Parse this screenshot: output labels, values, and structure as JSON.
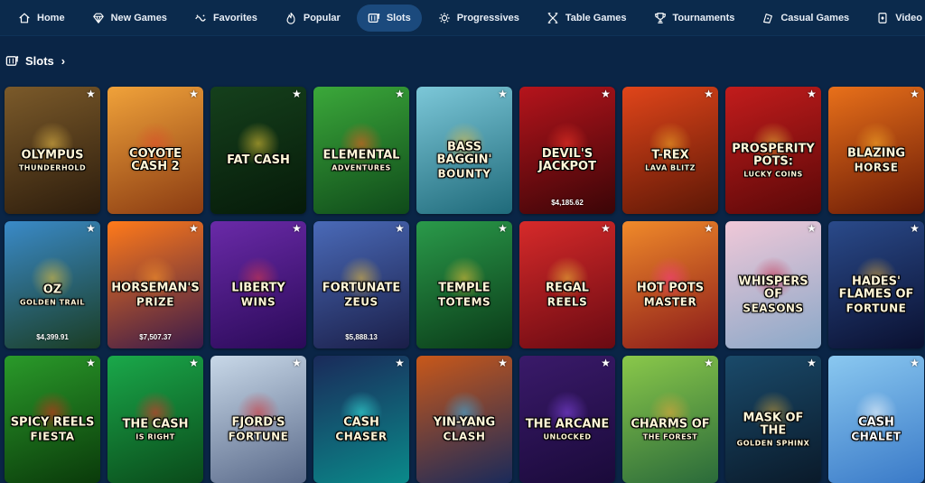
{
  "nav": {
    "items": [
      {
        "label": "Home",
        "icon": "home-icon",
        "active": false
      },
      {
        "label": "New Games",
        "icon": "diamond-icon",
        "active": false
      },
      {
        "label": "Favorites",
        "icon": "favorites-icon",
        "active": false
      },
      {
        "label": "Popular",
        "icon": "flame-icon",
        "active": false
      },
      {
        "label": "Slots",
        "icon": "slot-machine-icon",
        "active": true
      },
      {
        "label": "Progressives",
        "icon": "progressives-icon",
        "active": false
      },
      {
        "label": "Table Games",
        "icon": "cards-icon",
        "active": false
      },
      {
        "label": "Tournaments",
        "icon": "trophy-icon",
        "active": false
      },
      {
        "label": "Casual Games",
        "icon": "casual-icon",
        "active": false
      },
      {
        "label": "Video Poker",
        "icon": "video-poker-icon",
        "active": false
      }
    ]
  },
  "section": {
    "title": "Slots",
    "icon": "slot-machine-icon",
    "chevron": "›"
  },
  "games": [
    {
      "title": "Olympus",
      "subtitle": "Thunderhold",
      "jackpot": "",
      "bg": [
        "#7b5a2a",
        "#2c1c0c"
      ],
      "accent": "#f1c44b"
    },
    {
      "title": "Coyote Cash 2",
      "subtitle": "",
      "jackpot": "",
      "bg": [
        "#f0a23a",
        "#8a3b12"
      ],
      "accent": "#e14b2a"
    },
    {
      "title": "Fat Cash",
      "subtitle": "",
      "jackpot": "",
      "bg": [
        "#15401c",
        "#061a09"
      ],
      "accent": "#f5d23a"
    },
    {
      "title": "Elemental",
      "subtitle": "Adventures",
      "jackpot": "",
      "bg": [
        "#3ba83a",
        "#0f4a1a"
      ],
      "accent": "#ff5a1f"
    },
    {
      "title": "Bass Baggin'",
      "subtitle": "Bounty",
      "jackpot": "",
      "bg": [
        "#7cc7d8",
        "#1f6a7a"
      ],
      "accent": "#f2c23b"
    },
    {
      "title": "Devil's Jackpot",
      "subtitle": "",
      "jackpot": "$4,185.62",
      "bg": [
        "#b5141c",
        "#3a0507"
      ],
      "accent": "#ff3a2a"
    },
    {
      "title": "T-Rex",
      "subtitle": "Lava Blitz",
      "jackpot": "",
      "bg": [
        "#e0451a",
        "#5c1706"
      ],
      "accent": "#f7b02a"
    },
    {
      "title": "Prosperity Pots:",
      "subtitle": "Lucky Coins",
      "jackpot": "",
      "bg": [
        "#c21c1c",
        "#5a0808"
      ],
      "accent": "#f5c63a"
    },
    {
      "title": "Blazing",
      "subtitle": "Horse",
      "jackpot": "",
      "bg": [
        "#e8701a",
        "#6a1a06"
      ],
      "accent": "#ffb32a"
    },
    {
      "title": "Oz",
      "subtitle": "Golden Trail",
      "jackpot": "$4,399.91",
      "bg": [
        "#3a8ac8",
        "#1a3d24"
      ],
      "accent": "#f5c83a"
    },
    {
      "title": "Horseman's",
      "subtitle": "Prize",
      "jackpot": "$7,507.37",
      "bg": [
        "#ff7a1a",
        "#3a1a4a"
      ],
      "accent": "#ff9a2a"
    },
    {
      "title": "Liberty",
      "subtitle": "Wins",
      "jackpot": "",
      "bg": [
        "#6a2aa8",
        "#2a0a58"
      ],
      "accent": "#e23a4a"
    },
    {
      "title": "Fortunate",
      "subtitle": "Zeus",
      "jackpot": "$5,888.13",
      "bg": [
        "#4a6ab8",
        "#1a1e48"
      ],
      "accent": "#f5c63a"
    },
    {
      "title": "Temple",
      "subtitle": "Totems",
      "jackpot": "",
      "bg": [
        "#2a9a4a",
        "#0a3a18"
      ],
      "accent": "#f5c63a"
    },
    {
      "title": "Regal",
      "subtitle": "Reels",
      "jackpot": "",
      "bg": [
        "#d62a2a",
        "#6a0a12"
      ],
      "accent": "#f5c63a"
    },
    {
      "title": "Hot Pots",
      "subtitle": "Master",
      "jackpot": "",
      "bg": [
        "#f08a2a",
        "#8a1a1a"
      ],
      "accent": "#ff3a8a"
    },
    {
      "title": "Whispers of",
      "subtitle": "Seasons",
      "jackpot": "",
      "bg": [
        "#f0c8d8",
        "#8aa8c8"
      ],
      "accent": "#c81a3a"
    },
    {
      "title": "Hades' Flames of",
      "subtitle": "Fortune",
      "jackpot": "",
      "bg": [
        "#2a4a8a",
        "#0a1030"
      ],
      "accent": "#f5b83a"
    },
    {
      "title": "Spicy Reels",
      "subtitle": "Fiesta",
      "jackpot": "",
      "bg": [
        "#2a9a2a",
        "#0a3a0a"
      ],
      "accent": "#e8281a"
    },
    {
      "title": "The Cash",
      "subtitle": "is Right",
      "jackpot": "",
      "bg": [
        "#1aa84a",
        "#0a4a1a"
      ],
      "accent": "#ff2a2a"
    },
    {
      "title": "Fjord's",
      "subtitle": "Fortune",
      "jackpot": "",
      "bg": [
        "#c8d8e8",
        "#5a6a8a"
      ],
      "accent": "#d82a2a"
    },
    {
      "title": "Cash",
      "subtitle": "Chaser",
      "jackpot": "",
      "bg": [
        "#1a2a5a",
        "#0a8a8a"
      ],
      "accent": "#3af0e8"
    },
    {
      "title": "Yin-Yang",
      "subtitle": "Clash",
      "jackpot": "",
      "bg": [
        "#c8581a",
        "#1a2a5a"
      ],
      "accent": "#3ab8f0"
    },
    {
      "title": "The Arcane",
      "subtitle": "Unlocked",
      "jackpot": "",
      "bg": [
        "#3a1a6a",
        "#1a0a3a"
      ],
      "accent": "#8a4af0"
    },
    {
      "title": "Charms of",
      "subtitle": "the Forest",
      "jackpot": "",
      "bg": [
        "#8ac84a",
        "#2a6a3a"
      ],
      "accent": "#f0a83a"
    },
    {
      "title": "Mask of the",
      "subtitle": "Golden Sphinx",
      "jackpot": "",
      "bg": [
        "#1a4a6a",
        "#0a1a2a"
      ],
      "accent": "#d8a83a"
    },
    {
      "title": "Cash",
      "subtitle": "Chalet",
      "jackpot": "",
      "bg": [
        "#8ac8f0",
        "#3a7ac8"
      ],
      "accent": "#ffffff"
    }
  ]
}
